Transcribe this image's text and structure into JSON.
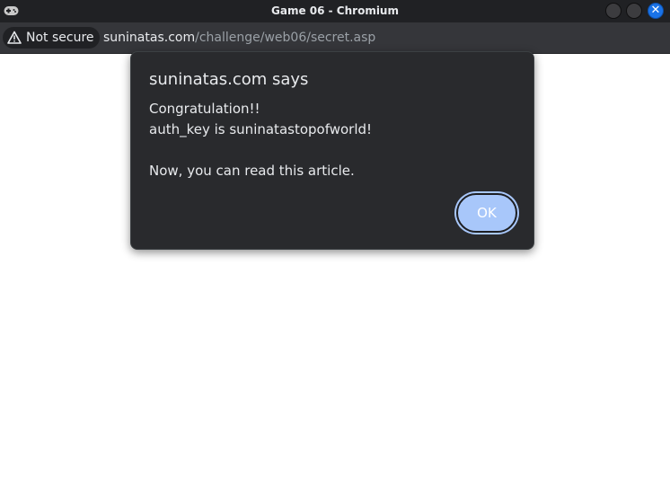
{
  "window": {
    "title": "Game 06 - Chromium",
    "close_glyph": "✕",
    "app_icon": "gamepad-icon"
  },
  "addressbar": {
    "security_label": "Not secure",
    "security_icon": "warning-triangle-icon",
    "url_host": "suninatas.com",
    "url_path": "/challenge/web06/secret.asp"
  },
  "dialog": {
    "title": "suninatas.com says",
    "message_lines": [
      "Congratulation!!",
      "auth_key is suninatastopofworld!",
      "",
      "Now, you can read this article."
    ],
    "ok_label": "OK"
  },
  "colors": {
    "titlebar": "#202124",
    "addressbar": "#35363a",
    "dialog_background": "#292a2d",
    "accent": "#a8c7fa",
    "close_button": "#1a73e8",
    "page_background": "#ffffff"
  }
}
